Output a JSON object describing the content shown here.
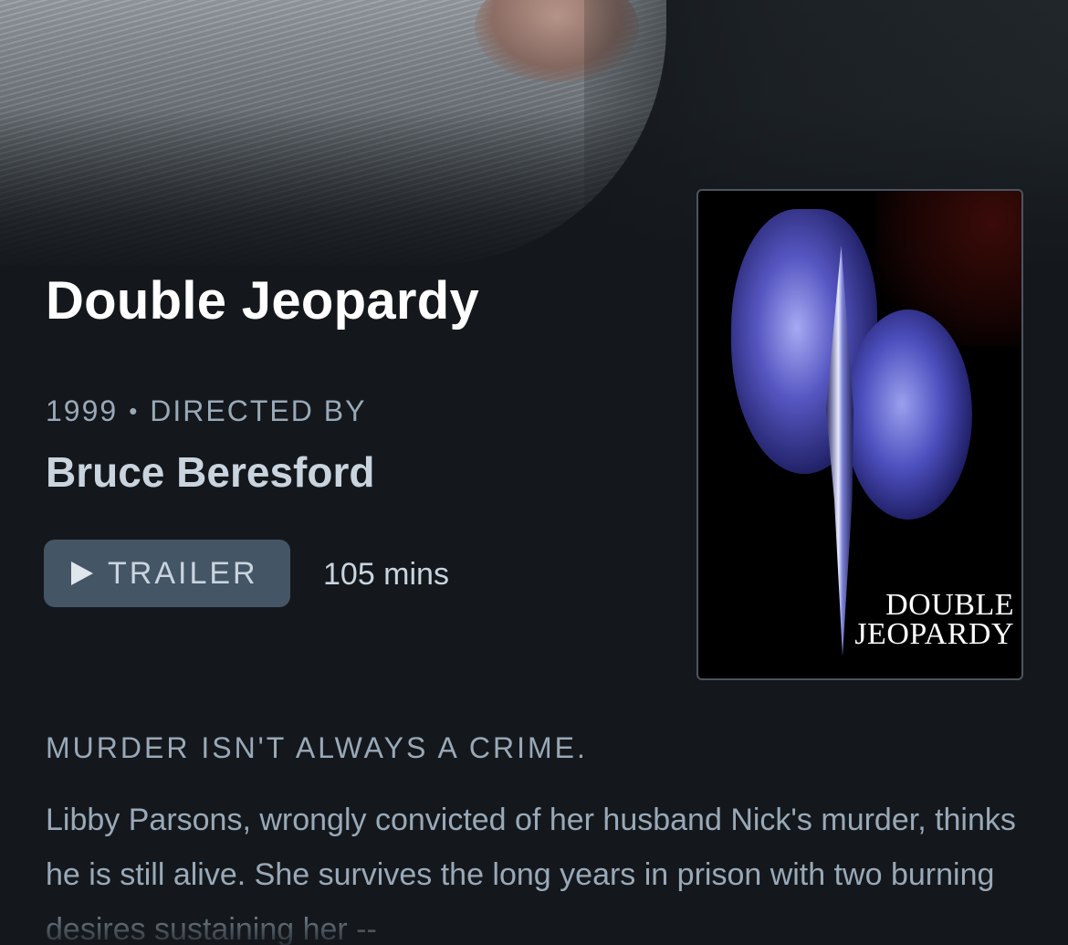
{
  "film": {
    "title": "Double Jeopardy",
    "year": "1999",
    "separator": "•",
    "directed_by_label": "DIRECTED BY",
    "director": "Bruce Beresford",
    "runtime": "105 mins"
  },
  "actions": {
    "trailer_label": "TRAILER"
  },
  "poster": {
    "title_line1": "DOUBLE",
    "title_line2": "JEOPARDY"
  },
  "tagline": "MURDER ISN'T ALWAYS A CRIME.",
  "synopsis": "Libby Parsons, wrongly convicted of her husband Nick's murder, thinks he is still alive. She survives the long years in prison with two burning desires sustaining her --",
  "icons": {
    "trailer": "play-icon"
  },
  "colors": {
    "background": "#14181c",
    "button": "#445566",
    "muted_text": "#99a9b8",
    "director_text": "#c9d4df"
  }
}
